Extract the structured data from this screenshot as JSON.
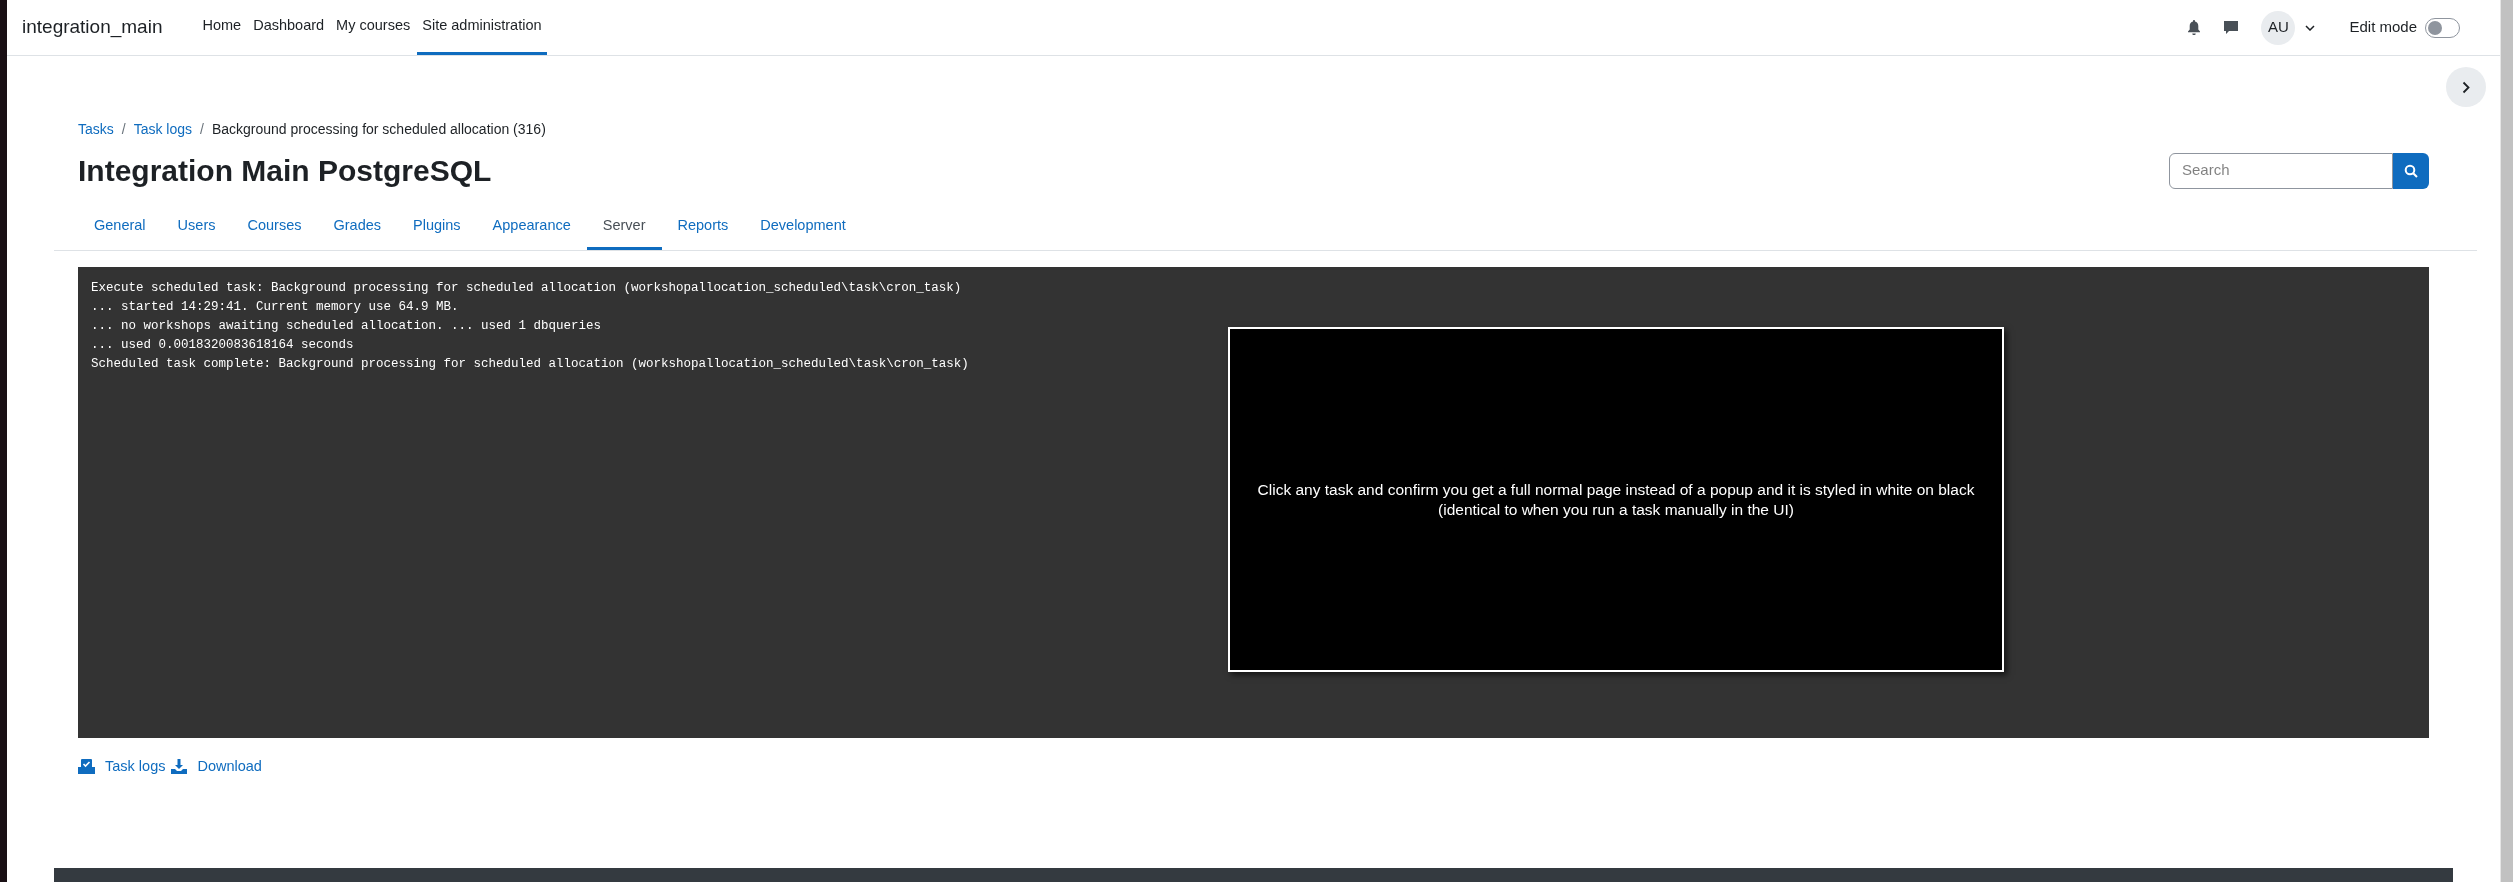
{
  "navbar": {
    "site_name": "integration_main",
    "items": [
      {
        "label": "Home",
        "selected": false
      },
      {
        "label": "Dashboard",
        "selected": false
      },
      {
        "label": "My courses",
        "selected": false
      },
      {
        "label": "Site administration",
        "selected": true
      }
    ],
    "avatar": "AU",
    "edit_mode": {
      "label": "Edit mode",
      "on": false
    }
  },
  "breadcrumb": [
    "Tasks",
    "Task logs",
    "Background processing for scheduled allocation (316)"
  ],
  "breadcrumb_separators": [
    "/",
    "/"
  ],
  "page_title": "Integration Main PostgreSQL",
  "search": {
    "placeholder": "Search"
  },
  "tabs": [
    {
      "label": "General",
      "selected": false
    },
    {
      "label": "Users",
      "selected": false
    },
    {
      "label": "Courses",
      "selected": false
    },
    {
      "label": "Grades",
      "selected": false
    },
    {
      "label": "Plugins",
      "selected": false
    },
    {
      "label": "Appearance",
      "selected": false
    },
    {
      "label": "Server",
      "selected": true
    },
    {
      "label": "Reports",
      "selected": false
    },
    {
      "label": "Development",
      "selected": false
    }
  ],
  "log_lines": [
    "Execute scheduled task: Background processing for scheduled allocation (workshopallocation_scheduled\\task\\cron_task)",
    "... started 14:29:41. Current memory use 64.9 MB.",
    "... no workshops awaiting scheduled allocation. ... used 1 dbqueries",
    "... used 0.0018320083618164 seconds",
    "Scheduled task complete: Background processing for scheduled allocation (workshopallocation_scheduled\\task\\cron_task)"
  ],
  "overlay_note": [
    "Click any task and confirm you get a full normal page instead of a popup and it is styled in white on black",
    "(identical to when you run a task manually in the UI)"
  ],
  "actions": [
    {
      "kind": "logs",
      "label": "Task logs"
    },
    {
      "kind": "download",
      "label": "Download"
    }
  ]
}
